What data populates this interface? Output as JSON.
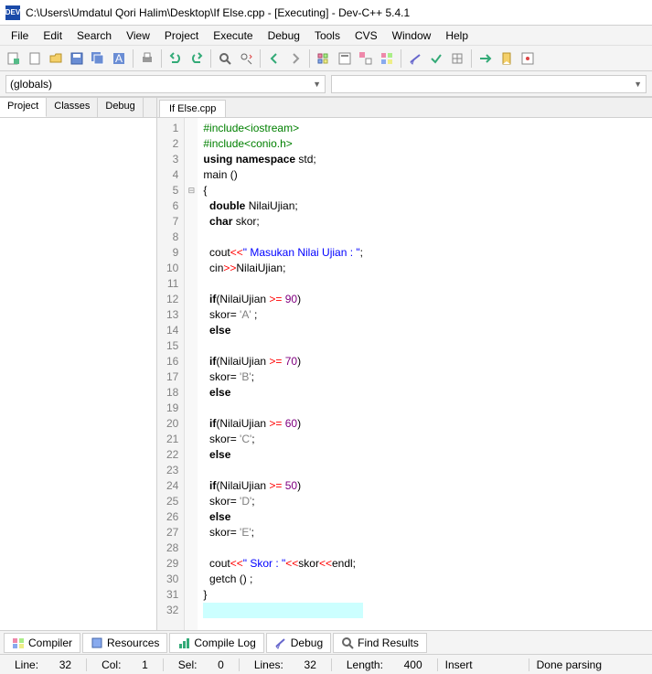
{
  "title": "C:\\Users\\Umdatul Qori Halim\\Desktop\\If Else.cpp - [Executing] - Dev-C++ 5.4.1",
  "menu": [
    "File",
    "Edit",
    "Search",
    "View",
    "Project",
    "Execute",
    "Debug",
    "Tools",
    "CVS",
    "Window",
    "Help"
  ],
  "combo_left": "(globals)",
  "left_tabs": [
    "Project",
    "Classes",
    "Debug"
  ],
  "doc_tab": "If Else.cpp",
  "code": [
    {
      "n": 1,
      "t": [
        [
          "pp",
          "#include<iostream>"
        ]
      ]
    },
    {
      "n": 2,
      "t": [
        [
          "pp",
          "#include<conio.h>"
        ]
      ]
    },
    {
      "n": 3,
      "t": [
        [
          "kw",
          "using"
        ],
        [
          "",
          " "
        ],
        [
          "kw",
          "namespace"
        ],
        [
          "",
          " std;"
        ]
      ]
    },
    {
      "n": 4,
      "t": [
        [
          "",
          "main ()"
        ]
      ]
    },
    {
      "n": 5,
      "fold": "⊟",
      "t": [
        [
          "",
          "{"
        ]
      ]
    },
    {
      "n": 6,
      "t": [
        [
          "kw",
          "double"
        ],
        [
          "",
          " NilaiUjian;"
        ]
      ]
    },
    {
      "n": 7,
      "t": [
        [
          "kw",
          "char"
        ],
        [
          "",
          " skor;"
        ]
      ]
    },
    {
      "n": 8,
      "t": [
        [
          "",
          ""
        ]
      ]
    },
    {
      "n": 9,
      "t": [
        [
          "",
          "cout"
        ],
        [
          "op",
          "<<"
        ],
        [
          "str",
          "\" Masukan Nilai Ujian : \""
        ],
        [
          "",
          ";"
        ]
      ]
    },
    {
      "n": 10,
      "t": [
        [
          "",
          "cin"
        ],
        [
          "op",
          ">>"
        ],
        [
          "",
          "NilaiUjian;"
        ]
      ]
    },
    {
      "n": 11,
      "t": [
        [
          "",
          ""
        ]
      ]
    },
    {
      "n": 12,
      "t": [
        [
          "kw",
          "if"
        ],
        [
          "",
          "(NilaiUjian "
        ],
        [
          "op",
          ">="
        ],
        [
          "",
          " "
        ],
        [
          "num",
          "90"
        ],
        [
          "",
          ")"
        ]
      ]
    },
    {
      "n": 13,
      "t": [
        [
          "",
          "skor= "
        ],
        [
          "ch",
          "'A'"
        ],
        [
          "",
          " ;"
        ]
      ]
    },
    {
      "n": 14,
      "t": [
        [
          "kw",
          "else"
        ]
      ]
    },
    {
      "n": 15,
      "t": [
        [
          "",
          ""
        ]
      ]
    },
    {
      "n": 16,
      "t": [
        [
          "kw",
          "if"
        ],
        [
          "",
          "(NilaiUjian "
        ],
        [
          "op",
          ">="
        ],
        [
          "",
          " "
        ],
        [
          "num",
          "70"
        ],
        [
          "",
          ")"
        ]
      ]
    },
    {
      "n": 17,
      "t": [
        [
          "",
          "skor= "
        ],
        [
          "ch",
          "'B'"
        ],
        [
          "",
          ";"
        ]
      ]
    },
    {
      "n": 18,
      "t": [
        [
          "kw",
          "else"
        ]
      ]
    },
    {
      "n": 19,
      "t": [
        [
          "",
          ""
        ]
      ]
    },
    {
      "n": 20,
      "t": [
        [
          "kw",
          "if"
        ],
        [
          "",
          "(NilaiUjian "
        ],
        [
          "op",
          ">="
        ],
        [
          "",
          " "
        ],
        [
          "num",
          "60"
        ],
        [
          "",
          ")"
        ]
      ]
    },
    {
      "n": 21,
      "t": [
        [
          "",
          "skor= "
        ],
        [
          "ch",
          "'C'"
        ],
        [
          "",
          ";"
        ]
      ]
    },
    {
      "n": 22,
      "t": [
        [
          "kw",
          "else"
        ]
      ]
    },
    {
      "n": 23,
      "t": [
        [
          "",
          ""
        ]
      ]
    },
    {
      "n": 24,
      "t": [
        [
          "kw",
          "if"
        ],
        [
          "",
          "(NilaiUjian "
        ],
        [
          "op",
          ">="
        ],
        [
          "",
          " "
        ],
        [
          "num",
          "50"
        ],
        [
          "",
          ")"
        ]
      ]
    },
    {
      "n": 25,
      "t": [
        [
          "",
          "skor= "
        ],
        [
          "ch",
          "'D'"
        ],
        [
          "",
          ";"
        ]
      ]
    },
    {
      "n": 26,
      "t": [
        [
          "kw",
          "else"
        ]
      ]
    },
    {
      "n": 27,
      "t": [
        [
          "",
          "skor= "
        ],
        [
          "ch",
          "'E'"
        ],
        [
          "",
          ";"
        ]
      ]
    },
    {
      "n": 28,
      "t": [
        [
          "",
          ""
        ]
      ]
    },
    {
      "n": 29,
      "t": [
        [
          "",
          "cout"
        ],
        [
          "op",
          "<<"
        ],
        [
          "str",
          "\" Skor : \""
        ],
        [
          "op",
          "<<"
        ],
        [
          "",
          "skor"
        ],
        [
          "op",
          "<<"
        ],
        [
          "",
          "endl;"
        ]
      ]
    },
    {
      "n": 30,
      "t": [
        [
          "",
          "getch () ;"
        ]
      ]
    },
    {
      "n": 31,
      "t": [
        [
          "",
          "}"
        ]
      ]
    },
    {
      "n": 32,
      "cur": true,
      "t": [
        [
          "",
          ""
        ]
      ]
    }
  ],
  "bottom_tabs": [
    "Compiler",
    "Resources",
    "Compile Log",
    "Debug",
    "Find Results"
  ],
  "status": {
    "line_lbl": "Line:",
    "line": "32",
    "col_lbl": "Col:",
    "col": "1",
    "sel_lbl": "Sel:",
    "sel": "0",
    "lines_lbl": "Lines:",
    "lines": "32",
    "len_lbl": "Length:",
    "len": "400",
    "mode": "Insert",
    "state": "Done parsing"
  }
}
